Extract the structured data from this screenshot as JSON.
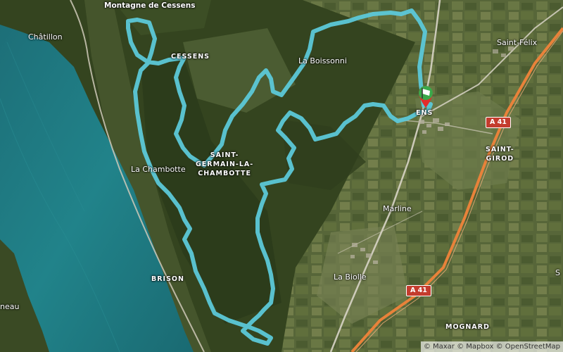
{
  "map": {
    "labels": {
      "montagne_de_cessens": "Montagne de Cessens",
      "chatillon": "Châtillon",
      "cessens": "CESSENS",
      "la_boissonni": "La Boissonni",
      "saint_felix": "Saint-Félix",
      "saint_girod": "SAINT-\nGIROD",
      "saint_germain": "SAINT-\nGERMAIN-LA-\nCHAMBOTTE",
      "la_chambotte": "La Chambotte",
      "marline": "Marline",
      "la_biolle": "La Biolle",
      "brison": "BRISON",
      "mognard": "MOGNARD",
      "eau": "neau",
      "partial_s": "S",
      "partial_sens": "ENS",
      "partial_s2": "S"
    },
    "road_shields": {
      "a41_top": "A 41",
      "a41_bottom": "A 41"
    },
    "attribution": "© Maxar © Mapbox © OpenStreetMap",
    "route_color": "#5cc8d8",
    "lake_color": "#1f7f86",
    "motorway_color": "#e8823a",
    "marker_colors": {
      "green": "#3aa84a",
      "white": "#ffffff",
      "red": "#e32b2b"
    }
  }
}
